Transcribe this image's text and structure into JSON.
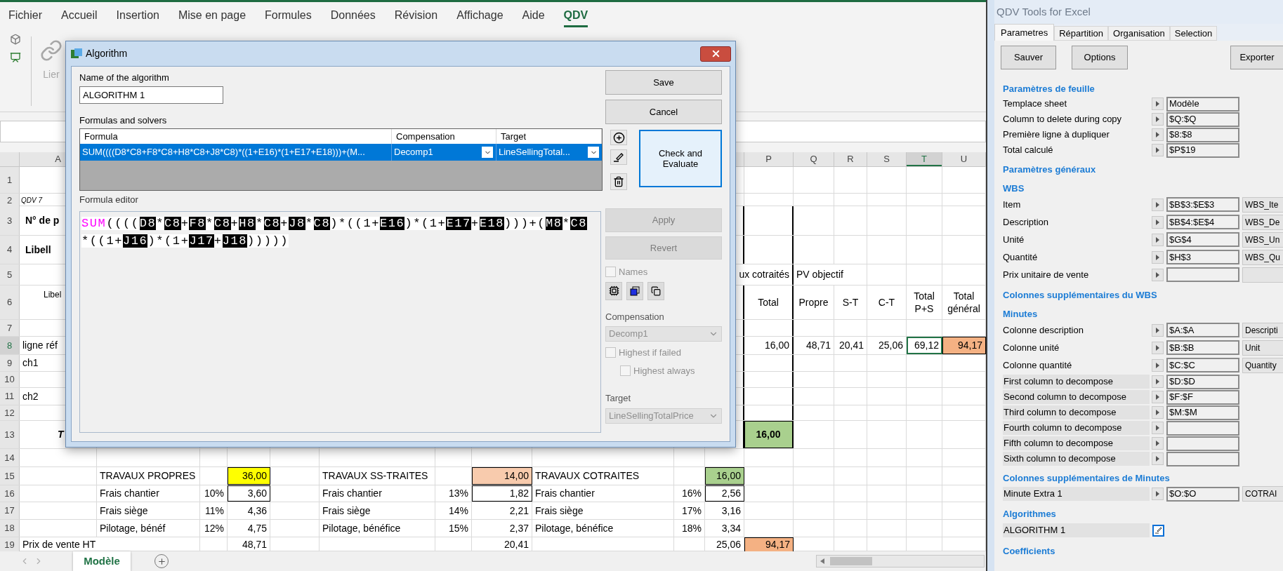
{
  "ribbon": {
    "tabs": [
      {
        "label": "Fichier",
        "selected": false
      },
      {
        "label": "Accueil",
        "selected": false
      },
      {
        "label": "Insertion",
        "selected": false
      },
      {
        "label": "Mise en page",
        "selected": false
      },
      {
        "label": "Formules",
        "selected": false
      },
      {
        "label": "Données",
        "selected": false
      },
      {
        "label": "Révision",
        "selected": false
      },
      {
        "label": "Affichage",
        "selected": false
      },
      {
        "label": "Aide",
        "selected": false
      },
      {
        "label": "QDV",
        "selected": true
      }
    ],
    "commands": [
      {
        "label": "Lier",
        "disabled": true
      }
    ]
  },
  "sheet": {
    "columns": [
      {
        "letter": "A",
        "selected": false
      },
      {
        "letter": "P",
        "selected": false
      },
      {
        "letter": "Q",
        "selected": false
      },
      {
        "letter": "R",
        "selected": false
      },
      {
        "letter": "S",
        "selected": false
      },
      {
        "letter": "T",
        "selected": true
      },
      {
        "letter": "U",
        "selected": false
      }
    ],
    "rows": [
      {
        "number": "1",
        "selected": false
      },
      {
        "number": "2",
        "selected": false,
        "cells": [
          {
            "kind": "note",
            "text": "QDV 7",
            "selected": false
          }
        ]
      },
      {
        "number": "3",
        "selected": false,
        "cells": [
          {
            "kind": "title",
            "text": "N° de p",
            "selected": false
          }
        ]
      },
      {
        "number": "4",
        "selected": false,
        "cells": [
          {
            "kind": "title",
            "text": "Libell",
            "selected": false
          }
        ]
      },
      {
        "number": "5",
        "selected": false,
        "cells": [
          {
            "kind": "blank"
          },
          {
            "kind": "blank"
          },
          {
            "kind": "blank"
          },
          {
            "kind": "blank"
          },
          {
            "kind": "blank"
          },
          {
            "kind": "blank"
          },
          {
            "kind": "blank"
          },
          {
            "kind": "blank"
          },
          {
            "kind": "blank"
          },
          {
            "kind": "blank"
          },
          {
            "kind": "wide_right",
            "text": "ux cotraités",
            "selected": false
          },
          {
            "kind": "wide_text",
            "text": "PV objectif",
            "selected": false
          }
        ]
      },
      {
        "number": "6",
        "selected": false,
        "cells": [
          {
            "kind": "small",
            "text": "Libel",
            "selected": false
          },
          {
            "kind": "blank"
          },
          {
            "kind": "blank"
          },
          {
            "kind": "blank"
          },
          {
            "kind": "blank"
          },
          {
            "kind": "blank"
          },
          {
            "kind": "blank"
          },
          {
            "kind": "blank"
          },
          {
            "kind": "blank"
          },
          {
            "kind": "blank"
          },
          {
            "kind": "blank"
          },
          {
            "kind": "header",
            "text": "Total",
            "selected": false
          },
          {
            "kind": "header",
            "text": "Propre",
            "selected": false
          },
          {
            "kind": "header",
            "text": "S-T",
            "selected": false
          },
          {
            "kind": "header",
            "text": "C-T",
            "selected": false
          },
          {
            "kind": "header",
            "text": "Total P+S",
            "selected": false
          },
          {
            "kind": "header",
            "text": "Total général",
            "selected": false
          }
        ]
      },
      {
        "number": "7",
        "selected": false
      },
      {
        "number": "8",
        "selected": true,
        "cells": [
          {
            "kind": "text",
            "text": "ligne réf",
            "selected": false
          },
          {
            "kind": "blank"
          },
          {
            "kind": "blank"
          },
          {
            "kind": "blank"
          },
          {
            "kind": "blank"
          },
          {
            "kind": "blank"
          },
          {
            "kind": "blank"
          },
          {
            "kind": "blank"
          },
          {
            "kind": "blank"
          },
          {
            "kind": "blank"
          },
          {
            "kind": "blank"
          },
          {
            "kind": "number",
            "text": "16,00",
            "selected": false
          },
          {
            "kind": "number",
            "text": "48,71",
            "selected": false
          },
          {
            "kind": "number",
            "text": "20,41",
            "selected": false
          },
          {
            "kind": "number",
            "text": "25,06",
            "selected": false
          },
          {
            "kind": "number",
            "text": "69,12",
            "selected": true
          },
          {
            "kind": "number",
            "text": "94,17",
            "color": "#f4b183",
            "selected": false
          }
        ]
      },
      {
        "number": "9",
        "selected": false,
        "cells": [
          {
            "kind": "text",
            "text": "ch1",
            "selected": false
          }
        ]
      },
      {
        "number": "10",
        "selected": false
      },
      {
        "number": "11",
        "selected": false,
        "cells": [
          {
            "kind": "text",
            "text": "ch2",
            "selected": false
          }
        ]
      },
      {
        "number": "12",
        "selected": false
      },
      {
        "number": "13",
        "selected": false,
        "cells": [
          {
            "kind": "total_label",
            "text": "T",
            "selected": false
          },
          {
            "kind": "blank"
          },
          {
            "kind": "blank"
          },
          {
            "kind": "blank"
          },
          {
            "kind": "blank"
          },
          {
            "kind": "blank"
          },
          {
            "kind": "blank"
          },
          {
            "kind": "blank"
          },
          {
            "kind": "blank"
          },
          {
            "kind": "blank"
          },
          {
            "kind": "blank"
          },
          {
            "kind": "bold_number",
            "text": "16,00",
            "color": "#a9d08e",
            "selected": false
          }
        ]
      },
      {
        "number": "14",
        "selected": false
      },
      {
        "number": "15",
        "selected": false,
        "cells": [
          {
            "kind": "blank"
          },
          {
            "kind": "text",
            "text": "TRAVAUX PROPRES",
            "selected": false
          },
          {
            "kind": "blank"
          },
          {
            "kind": "number",
            "text": "36,00",
            "color": "#ffff00",
            "selected": false
          },
          {
            "kind": "blank"
          },
          {
            "kind": "text",
            "text": "TRAVAUX SS-TRAITES",
            "selected": false
          },
          {
            "kind": "blank"
          },
          {
            "kind": "number",
            "text": "14,00",
            "color": "#f8cbad",
            "selected": false
          },
          {
            "kind": "text",
            "text": "TRAVAUX COTRAITES",
            "selected": false
          },
          {
            "kind": "blank"
          },
          {
            "kind": "number",
            "text": "16,00",
            "color": "#a9d08e",
            "selected": false
          }
        ]
      },
      {
        "number": "16",
        "selected": false,
        "cells": [
          {
            "kind": "blank"
          },
          {
            "kind": "text",
            "text": "Frais chantier",
            "selected": false
          },
          {
            "kind": "number",
            "text": "10%",
            "selected": false
          },
          {
            "kind": "boxed_number",
            "text": "3,60",
            "selected": false
          },
          {
            "kind": "blank"
          },
          {
            "kind": "text",
            "text": "Frais chantier",
            "selected": false
          },
          {
            "kind": "number",
            "text": "13%",
            "selected": false
          },
          {
            "kind": "boxed_number",
            "text": "1,82",
            "selected": false
          },
          {
            "kind": "text",
            "text": "Frais chantier",
            "selected": false
          },
          {
            "kind": "number",
            "text": "16%",
            "selected": false
          },
          {
            "kind": "boxed_number",
            "text": "2,56",
            "selected": false
          }
        ]
      },
      {
        "number": "17",
        "selected": false,
        "cells": [
          {
            "kind": "blank"
          },
          {
            "kind": "text",
            "text": "Frais siège",
            "selected": false
          },
          {
            "kind": "number",
            "text": "11%",
            "selected": false
          },
          {
            "kind": "number",
            "text": "4,36",
            "selected": false
          },
          {
            "kind": "blank"
          },
          {
            "kind": "text",
            "text": "Frais siège",
            "selected": false
          },
          {
            "kind": "number",
            "text": "14%",
            "selected": false
          },
          {
            "kind": "number",
            "text": "2,21",
            "selected": false
          },
          {
            "kind": "text",
            "text": "Frais siège",
            "selected": false
          },
          {
            "kind": "number",
            "text": "17%",
            "selected": false
          },
          {
            "kind": "number",
            "text": "3,16",
            "selected": false
          }
        ]
      },
      {
        "number": "18",
        "selected": false,
        "cells": [
          {
            "kind": "blank"
          },
          {
            "kind": "text",
            "text": "Pilotage, bénéf",
            "selected": false
          },
          {
            "kind": "number",
            "text": "12%",
            "selected": false
          },
          {
            "kind": "number",
            "text": "4,75",
            "selected": false
          },
          {
            "kind": "blank"
          },
          {
            "kind": "text",
            "text": "Pilotage, bénéfice",
            "selected": false
          },
          {
            "kind": "number",
            "text": "15%",
            "selected": false
          },
          {
            "kind": "number",
            "text": "2,37",
            "selected": false
          },
          {
            "kind": "text",
            "text": "Pilotage, bénéfice",
            "selected": false
          },
          {
            "kind": "number",
            "text": "18%",
            "selected": false
          },
          {
            "kind": "number",
            "text": "3,34",
            "selected": false
          }
        ]
      },
      {
        "number": "19",
        "selected": false,
        "cells": [
          {
            "kind": "wide_text",
            "text": "Prix de vente HT",
            "selected": false
          },
          {
            "kind": "blank"
          },
          {
            "kind": "number",
            "text": "48,71",
            "selected": false
          },
          {
            "kind": "blank"
          },
          {
            "kind": "blank"
          },
          {
            "kind": "blank"
          },
          {
            "kind": "number",
            "text": "20,41",
            "selected": false
          },
          {
            "kind": "blank"
          },
          {
            "kind": "blank"
          },
          {
            "kind": "number",
            "text": "25,06",
            "selected": false
          },
          {
            "kind": "number",
            "text": "94,17",
            "color": "#f4b183",
            "selected": false
          }
        ]
      }
    ],
    "tabs": [
      {
        "label": "Modèle",
        "selected": true
      }
    ]
  },
  "dialog": {
    "title": "Algorithm",
    "name_label": "Name of the algorithm",
    "name_value": "ALGORITHM 1",
    "save": "Save",
    "cancel": "Cancel",
    "formulas_label": "Formulas and solvers",
    "grid": {
      "columns": [
        "Formula",
        "Compensation",
        "Target"
      ],
      "rows": [
        {
          "formula": "SUM((((D8*C8+F8*C8+H8*C8+J8*C8)*((1+E16)*(1+E17+E18)))+(M...",
          "compensation": "Decomp1",
          "target": "LineSellingTotal...",
          "selected": true
        }
      ]
    },
    "check": "Check and\nEvaluate",
    "editor_label": "Formula editor",
    "editor": {
      "lines": [
        [
          {
            "kind": "function",
            "text": "SUM"
          },
          {
            "kind": "operator",
            "text": "(((("
          },
          {
            "kind": "reference",
            "text": "D8"
          },
          {
            "kind": "operator",
            "text": "*"
          },
          {
            "kind": "reference",
            "text": "C8"
          },
          {
            "kind": "operator",
            "text": "+"
          },
          {
            "kind": "reference",
            "text": "F8"
          },
          {
            "kind": "operator",
            "text": "*"
          },
          {
            "kind": "reference",
            "text": "C8"
          },
          {
            "kind": "operator",
            "text": "+"
          },
          {
            "kind": "reference",
            "text": "H8"
          },
          {
            "kind": "operator",
            "text": "*"
          },
          {
            "kind": "reference",
            "text": "C8"
          },
          {
            "kind": "operator",
            "text": "+"
          },
          {
            "kind": "reference",
            "text": "J8"
          },
          {
            "kind": "operator",
            "text": "*"
          },
          {
            "kind": "reference",
            "text": "C8"
          },
          {
            "kind": "operator",
            "text": ")*((1+"
          },
          {
            "kind": "reference",
            "text": "E16"
          },
          {
            "kind": "operator",
            "text": ")*(1+"
          },
          {
            "kind": "reference",
            "text": "E17"
          },
          {
            "kind": "operator",
            "text": "+"
          },
          {
            "kind": "reference",
            "text": "E18"
          },
          {
            "kind": "operator",
            "text": ")))+("
          },
          {
            "kind": "reference",
            "text": "M8"
          },
          {
            "kind": "operator",
            "text": "*"
          },
          {
            "kind": "reference",
            "text": "C8"
          }
        ],
        [
          {
            "kind": "operator",
            "text": "*((1+"
          },
          {
            "kind": "reference",
            "text": "J16"
          },
          {
            "kind": "operator",
            "text": ")*(1+"
          },
          {
            "kind": "reference",
            "text": "J17"
          },
          {
            "kind": "operator",
            "text": "+"
          },
          {
            "kind": "reference",
            "text": "J18"
          },
          {
            "kind": "operator",
            "text": ")))))"
          }
        ]
      ]
    },
    "apply": {
      "label": "Apply",
      "disabled": true
    },
    "revert": {
      "label": "Revert",
      "disabled": true
    },
    "names": {
      "label": "Names",
      "checked": false,
      "disabled": true
    },
    "compensation_label": "Compensation",
    "compensation": {
      "value": "Decomp1",
      "disabled": true
    },
    "highest_if_failed": {
      "label": "Highest if failed",
      "checked": false,
      "disabled": true
    },
    "highest_always": {
      "label": "Highest always",
      "checked": false,
      "disabled": true
    },
    "target_label": "Target",
    "target": {
      "value": "LineSellingTotalPrice",
      "disabled": true
    }
  },
  "panel": {
    "title": "QDV Tools for Excel",
    "tabs": [
      {
        "label": "Parametres",
        "selected": true
      },
      {
        "label": "Répartition",
        "selected": false
      },
      {
        "label": "Organisation",
        "selected": false
      },
      {
        "label": "Selection",
        "selected": false
      }
    ],
    "buttons": [
      "Sauver",
      "Options",
      "Exporter"
    ],
    "sections": [
      {
        "heading": "Paramètres de feuille",
        "rows": [
          {
            "kind": "field",
            "label": "Templace sheet",
            "value": "Modèle"
          },
          {
            "kind": "field",
            "label": "Column to delete during copy",
            "value": "$Q:$Q"
          },
          {
            "kind": "field",
            "label": "Première ligne à dupliquer",
            "value": "$8:$8"
          },
          {
            "kind": "field",
            "label": "Total calculé",
            "value": "$P$19"
          }
        ]
      },
      {
        "heading": "Paramètres généraux"
      },
      {
        "heading": "WBS",
        "rows": [
          {
            "kind": "field_pair",
            "label": "Item",
            "value": "$B$3:$E$3",
            "extra": "WBS_Ite"
          },
          {
            "kind": "field_pair",
            "label": "Description",
            "value": "$B$4:$E$4",
            "extra": "WBS_De"
          },
          {
            "kind": "field_pair",
            "label": "Unité",
            "value": "$G$4",
            "extra": "WBS_Un"
          },
          {
            "kind": "field_pair",
            "label": "Quantité",
            "value": "$H$3",
            "extra": "WBS_Qu"
          },
          {
            "kind": "field_pair",
            "label": "Prix unitaire de vente"
          }
        ]
      },
      {
        "heading": "Colonnes supplémentaires du WBS"
      },
      {
        "heading": "Minutes",
        "rows": [
          {
            "kind": "field_pair",
            "label": "Colonne description",
            "value": "$A:$A",
            "extra": "Descripti"
          },
          {
            "kind": "field_pair",
            "label": "Colonne unité",
            "value": "$B:$B",
            "extra": "Unit"
          },
          {
            "kind": "field_pair",
            "label": "Colonne quantité",
            "value": "$C:$C",
            "extra": "Quantity"
          },
          {
            "kind": "shaded_field",
            "label": "First column to decompose",
            "value": "$D:$D"
          },
          {
            "kind": "shaded_field",
            "label": "Second column to decompose",
            "value": "$F:$F"
          },
          {
            "kind": "shaded_field",
            "label": "Third column to decompose",
            "value": "$M:$M"
          },
          {
            "kind": "shaded_field",
            "label": "Fourth column to decompose"
          },
          {
            "kind": "shaded_field",
            "label": "Fifth column to decompose"
          },
          {
            "kind": "shaded_field",
            "label": "Sixth column to decompose"
          }
        ]
      },
      {
        "heading": "Colonnes supplémentaires de Minutes",
        "rows": [
          {
            "kind": "shaded_pair",
            "label": "Minute Extra 1",
            "value": "$O:$O",
            "extra": "COTRAI"
          }
        ]
      },
      {
        "heading": "Algorithmes",
        "rows": [
          {
            "kind": "algorithm",
            "label": "ALGORITHM 1"
          }
        ]
      },
      {
        "heading": "Coefficients"
      }
    ]
  }
}
